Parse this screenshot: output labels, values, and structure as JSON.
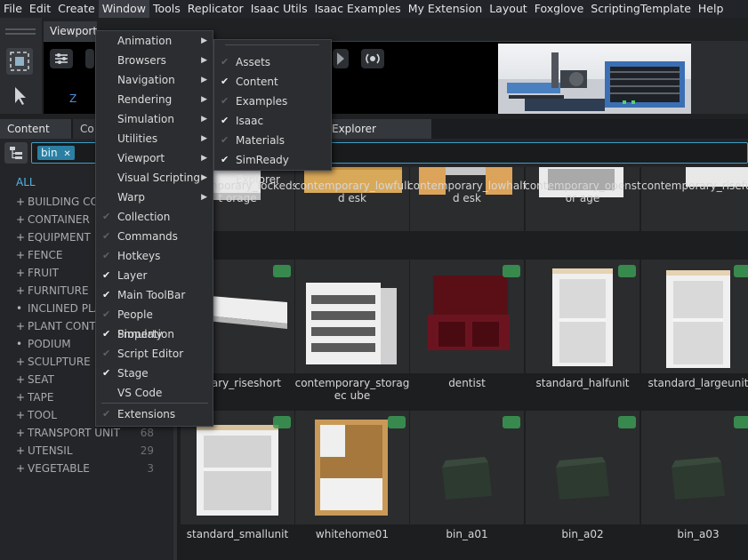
{
  "menubar": {
    "items": [
      "File",
      "Edit",
      "Create",
      "Window",
      "Tools",
      "Replicator",
      "Isaac Utils",
      "Isaac Examples",
      "My Extension",
      "Layout",
      "Foxglove",
      "ScriptingTemplate",
      "Help"
    ],
    "active": "Window"
  },
  "viewport": {
    "tab_label": "Viewport",
    "axis_label": "Z"
  },
  "panel_tabs": {
    "content": "Content",
    "content2": "Co",
    "explorer": "Explorer"
  },
  "search": {
    "chip": "bin",
    "chip_close": "✕"
  },
  "categories": {
    "all": "ALL",
    "items": [
      {
        "prefix": "+",
        "label": "BUILDING CO",
        "count": ""
      },
      {
        "prefix": "+",
        "label": "CONTAINER",
        "count": ""
      },
      {
        "prefix": "+",
        "label": "EQUIPMENT",
        "count": ""
      },
      {
        "prefix": "+",
        "label": "FENCE",
        "count": ""
      },
      {
        "prefix": "+",
        "label": "FRUIT",
        "count": ""
      },
      {
        "prefix": "+",
        "label": "FURNITURE",
        "count": ""
      },
      {
        "prefix": "•",
        "label": "INCLINED PLA",
        "count": ""
      },
      {
        "prefix": "+",
        "label": "PLANT CONTA",
        "count": ""
      },
      {
        "prefix": "•",
        "label": "PODIUM",
        "count": ""
      },
      {
        "prefix": "+",
        "label": "SCULPTURE",
        "count": ""
      },
      {
        "prefix": "+",
        "label": "SEAT",
        "count": ""
      },
      {
        "prefix": "+",
        "label": "TAPE",
        "count": ""
      },
      {
        "prefix": "+",
        "label": "TOOL",
        "count": ""
      },
      {
        "prefix": "+",
        "label": "TRANSPORT UNIT",
        "count": "68"
      },
      {
        "prefix": "+",
        "label": "UTENSIL",
        "count": "29"
      },
      {
        "prefix": "+",
        "label": "VEGETABLE",
        "count": "3"
      }
    ]
  },
  "grid": {
    "row1": [
      "contemporary_lockedst orage",
      "contemporary_lowfulld esk",
      "contemporary_lowhalfd esk",
      "contemporary_openstor age",
      "contemporary_riseful"
    ],
    "row2": [
      "porary_riseshort",
      "contemporary_storagec ube",
      "dentist",
      "standard_halfunit",
      "standard_largeunit"
    ],
    "row3": [
      "standard_smallunit",
      "whitehome01",
      "bin_a01",
      "bin_a02",
      "bin_a03"
    ]
  },
  "window_menu": {
    "items": [
      {
        "label": "Animation",
        "submenu": true,
        "check": "none"
      },
      {
        "label": "Browsers",
        "submenu": true,
        "check": "none"
      },
      {
        "label": "Navigation",
        "submenu": true,
        "check": "none"
      },
      {
        "label": "Rendering",
        "submenu": true,
        "check": "none"
      },
      {
        "label": "Simulation",
        "submenu": true,
        "check": "none"
      },
      {
        "label": "Utilities",
        "submenu": true,
        "check": "none"
      },
      {
        "label": "Viewport",
        "submenu": true,
        "check": "none"
      },
      {
        "label": "Visual Scripting",
        "submenu": true,
        "check": "none"
      },
      {
        "label": "Warp",
        "submenu": true,
        "check": "none"
      },
      {
        "label": "Collection",
        "submenu": false,
        "check": "off"
      },
      {
        "label": "Commands",
        "submenu": false,
        "check": "off"
      },
      {
        "label": "Hotkeys",
        "submenu": false,
        "check": "off"
      },
      {
        "label": "Layer",
        "submenu": false,
        "check": "on"
      },
      {
        "label": "Main ToolBar",
        "submenu": false,
        "check": "on"
      },
      {
        "label": "People Simulation",
        "submenu": false,
        "check": "off"
      },
      {
        "label": "Property",
        "submenu": false,
        "check": "on"
      },
      {
        "label": "Script Editor",
        "submenu": false,
        "check": "off"
      },
      {
        "label": "Stage",
        "submenu": false,
        "check": "on"
      },
      {
        "label": "VS Code",
        "submenu": false,
        "check": "none"
      },
      {
        "label": "Extensions",
        "submenu": false,
        "check": "off"
      }
    ],
    "check_glyph": "✔",
    "arrow_glyph": "▶"
  },
  "browsers_menu": {
    "items": [
      {
        "label": "Assets",
        "check": "off"
      },
      {
        "label": "Content",
        "check": "on"
      },
      {
        "label": "Examples",
        "check": "off"
      },
      {
        "label": "Isaac",
        "check": "on"
      },
      {
        "label": "Materials",
        "check": "off"
      },
      {
        "label": "SimReady Explorer",
        "check": "on"
      }
    ]
  },
  "colors": {
    "accent": "#3fa0c8",
    "chip": "#2b7fa3",
    "all_link": "#55b3e6",
    "badge": "#3b9a54"
  }
}
